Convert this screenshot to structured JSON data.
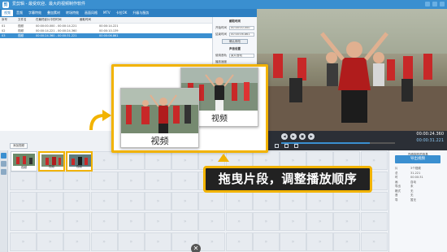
{
  "window": {
    "title": "爱剪辑 - 最受欢迎、最大的视频制作软件"
  },
  "app": {
    "logo_label": "剪"
  },
  "menu": {
    "tabs": [
      "视频",
      "音频",
      "字幕特效",
      "叠加素材",
      "转场特效",
      "画面风格",
      "MTV",
      "卡拉OK",
      "升级与服务"
    ]
  },
  "subtitle_list": {
    "headers": [
      "序号",
      "文件名",
      "在最终影片中的时间",
      "截取时间"
    ],
    "rows": [
      {
        "no": "01",
        "name": "视频",
        "final_time": "00:00:00.000 - 00:00:14.221",
        "cut_time": "00:00:14.221"
      },
      {
        "no": "02",
        "name": "视频",
        "final_time": "00:00:14.221 - 00:00:24.360",
        "cut_time": "00:00:10.139"
      },
      {
        "no": "03",
        "name": "视频",
        "final_time": "00:00:24.360 - 00:00:31.221",
        "cut_time": "00:00:06.861"
      }
    ]
  },
  "settings": {
    "section1": "截取时间",
    "start_label": "开始时间",
    "start_value": "00:00:00.000",
    "end_label": "结束时间",
    "end_value": "00:00:06.861",
    "apply_button": "确认修改",
    "section2": "声音设置",
    "volume_label": "使用音轨",
    "volume_value": "原片音轨",
    "speed_label": "播放速度"
  },
  "player": {
    "time_current": "00:00:24.360",
    "time_total": "00:00:31.221",
    "progress": 0.78
  },
  "timeline": {
    "add_button": "添加视频",
    "clips": [
      {
        "label": "视频",
        "selected": false
      },
      {
        "label": "视频",
        "selected": true
      },
      {
        "label": "视频",
        "selected": true
      }
    ]
  },
  "info_panel": {
    "title": "所有制作的信息",
    "export_button": "导出视频",
    "rows": [
      {
        "k": "片",
        "v": "3个视频"
      },
      {
        "k": "总",
        "v": "31.221"
      },
      {
        "k": "时",
        "v": "00:00:31"
      },
      {
        "k": "画",
        "v": "自动"
      },
      {
        "k": "导出",
        "v": "未"
      },
      {
        "k": "格式",
        "v": "无"
      },
      {
        "k": "音",
        "v": "无"
      },
      {
        "k": "导",
        "v": "暂无"
      }
    ]
  },
  "callout": {
    "card_front_label": "视频",
    "card_back_label": "视频"
  },
  "tip": {
    "text": "拖曳片段，调整播放顺序"
  },
  "colors": {
    "accent": "#3a8fd0",
    "highlight": "#f2b300",
    "tip_bg": "#222222"
  }
}
